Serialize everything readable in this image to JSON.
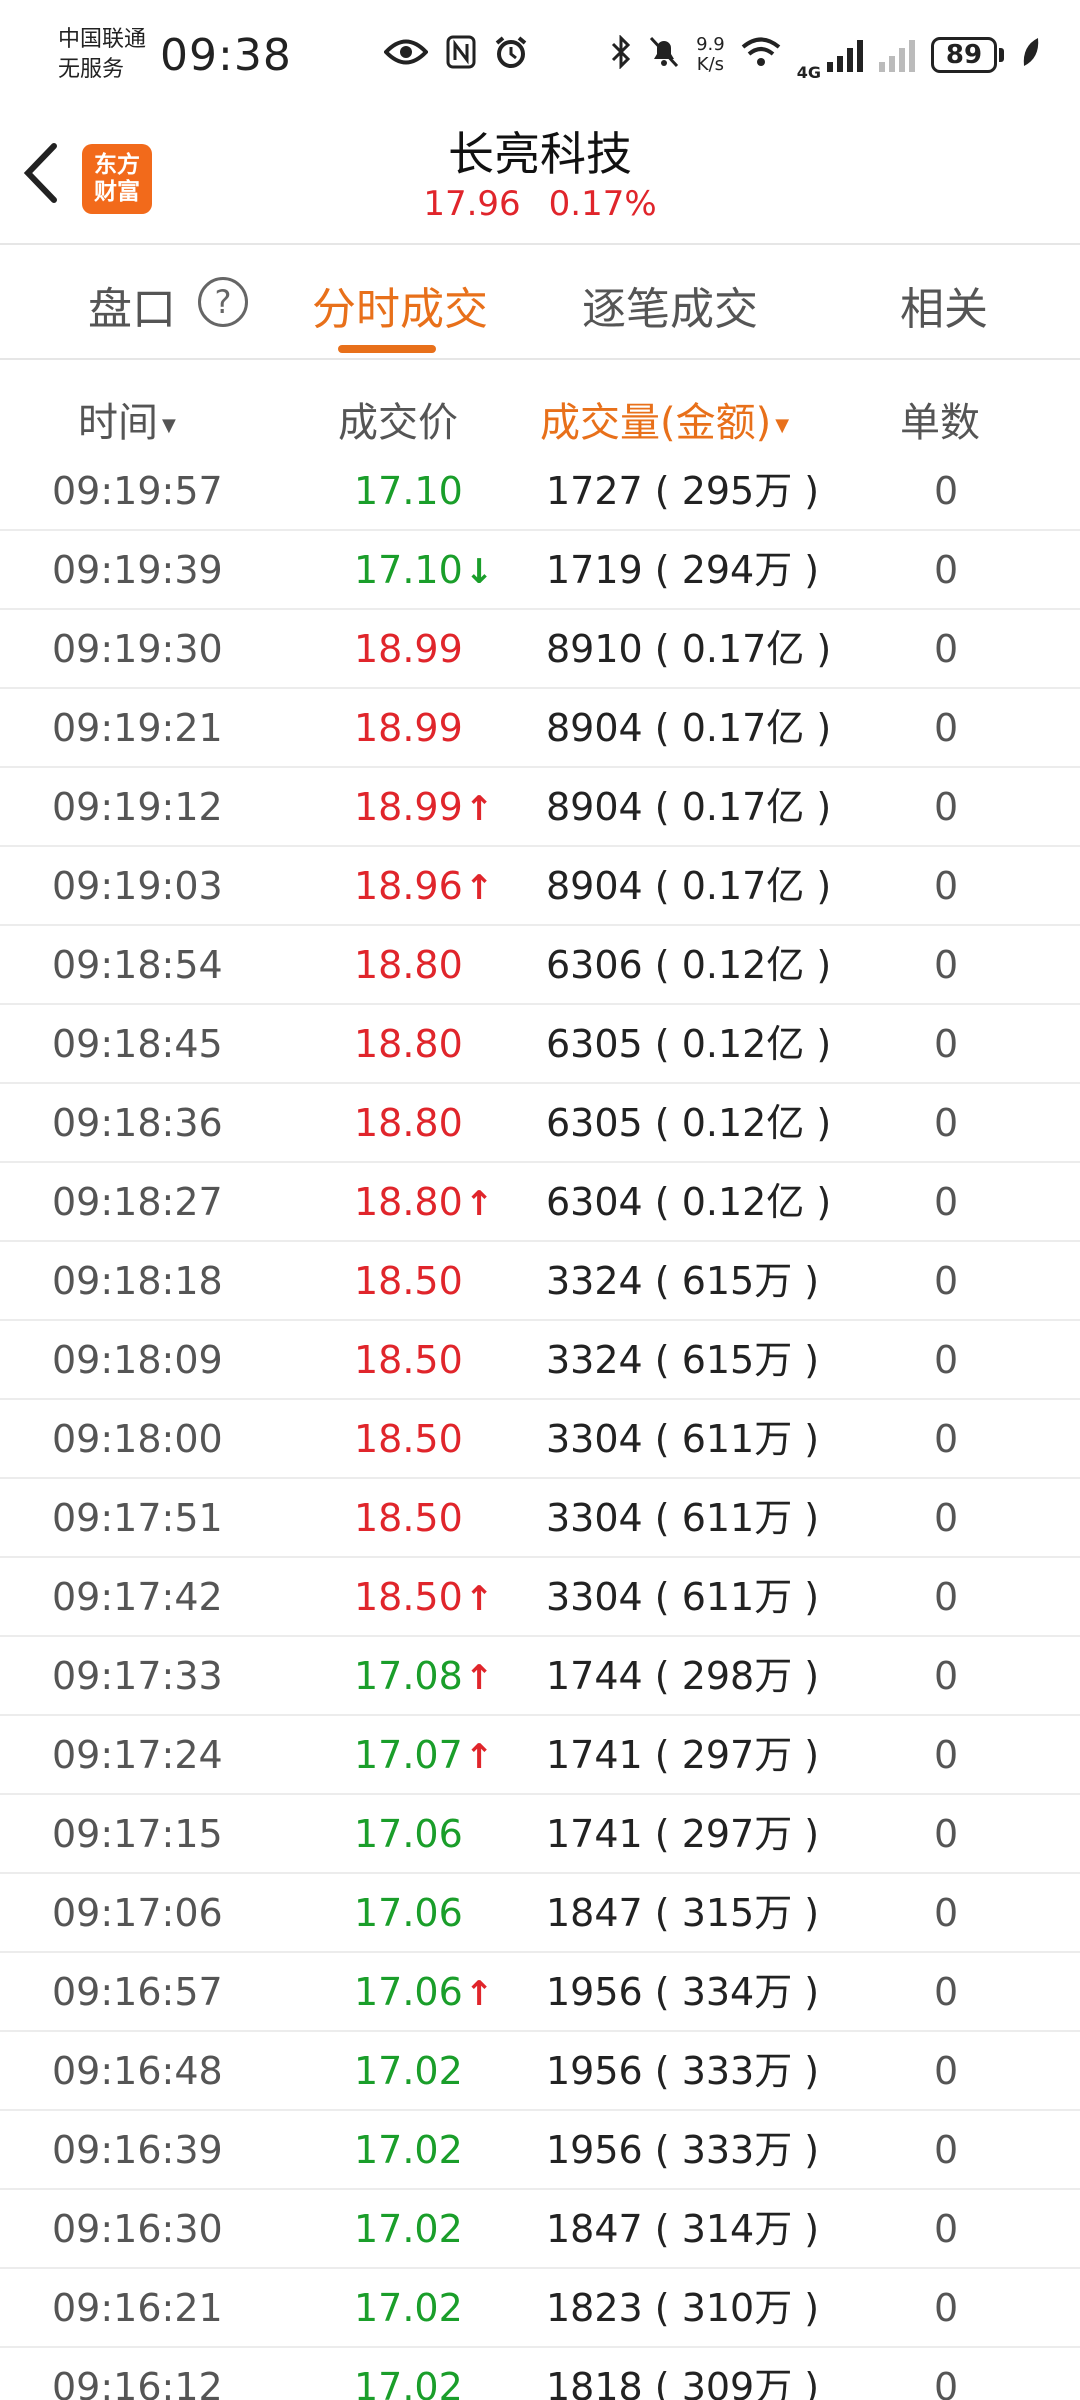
{
  "status_bar": {
    "carrier_line1": "中国联通",
    "carrier_line2": "无服务",
    "time": "09:38",
    "net_speed_value": "9.9",
    "net_speed_unit": "K/s",
    "network_type": "4G",
    "battery": "89"
  },
  "header": {
    "logo_line1": "东方",
    "logo_line2": "财富",
    "title": "长亮科技",
    "price": "17.96",
    "change_pct": "0.17%"
  },
  "tabs": {
    "panel": "盘口",
    "help": "?",
    "intraday_trades": "分时成交",
    "tick_trades": "逐笔成交",
    "related": "相关"
  },
  "columns": {
    "time": "时间",
    "price": "成交价",
    "volume": "成交量(金额)",
    "count": "单数"
  },
  "colors": {
    "up": "#e0252b",
    "down": "#1a9e2a",
    "accent": "#e8701a"
  },
  "trades": [
    {
      "time": "09:19:57",
      "price": "17.10",
      "color": "down",
      "arrow": "",
      "volume": "1727 ( 295万 )",
      "count": "0"
    },
    {
      "time": "09:19:39",
      "price": "17.10",
      "color": "down",
      "arrow": "down",
      "volume": "1719 ( 294万 )",
      "count": "0"
    },
    {
      "time": "09:19:30",
      "price": "18.99",
      "color": "up",
      "arrow": "",
      "volume": "8910 ( 0.17亿 )",
      "count": "0"
    },
    {
      "time": "09:19:21",
      "price": "18.99",
      "color": "up",
      "arrow": "",
      "volume": "8904 ( 0.17亿 )",
      "count": "0"
    },
    {
      "time": "09:19:12",
      "price": "18.99",
      "color": "up",
      "arrow": "up",
      "volume": "8904 ( 0.17亿 )",
      "count": "0"
    },
    {
      "time": "09:19:03",
      "price": "18.96",
      "color": "up",
      "arrow": "up",
      "volume": "8904 ( 0.17亿 )",
      "count": "0"
    },
    {
      "time": "09:18:54",
      "price": "18.80",
      "color": "up",
      "arrow": "",
      "volume": "6306 ( 0.12亿 )",
      "count": "0"
    },
    {
      "time": "09:18:45",
      "price": "18.80",
      "color": "up",
      "arrow": "",
      "volume": "6305 ( 0.12亿 )",
      "count": "0"
    },
    {
      "time": "09:18:36",
      "price": "18.80",
      "color": "up",
      "arrow": "",
      "volume": "6305 ( 0.12亿 )",
      "count": "0"
    },
    {
      "time": "09:18:27",
      "price": "18.80",
      "color": "up",
      "arrow": "up",
      "volume": "6304 ( 0.12亿 )",
      "count": "0"
    },
    {
      "time": "09:18:18",
      "price": "18.50",
      "color": "up",
      "arrow": "",
      "volume": "3324 ( 615万 )",
      "count": "0"
    },
    {
      "time": "09:18:09",
      "price": "18.50",
      "color": "up",
      "arrow": "",
      "volume": "3324 ( 615万 )",
      "count": "0"
    },
    {
      "time": "09:18:00",
      "price": "18.50",
      "color": "up",
      "arrow": "",
      "volume": "3304 ( 611万 )",
      "count": "0"
    },
    {
      "time": "09:17:51",
      "price": "18.50",
      "color": "up",
      "arrow": "",
      "volume": "3304 ( 611万 )",
      "count": "0"
    },
    {
      "time": "09:17:42",
      "price": "18.50",
      "color": "up",
      "arrow": "up",
      "volume": "3304 ( 611万 )",
      "count": "0"
    },
    {
      "time": "09:17:33",
      "price": "17.08",
      "color": "down",
      "arrow": "up",
      "volume": "1744 ( 298万 )",
      "count": "0"
    },
    {
      "time": "09:17:24",
      "price": "17.07",
      "color": "down",
      "arrow": "up",
      "volume": "1741 ( 297万 )",
      "count": "0"
    },
    {
      "time": "09:17:15",
      "price": "17.06",
      "color": "down",
      "arrow": "",
      "volume": "1741 ( 297万 )",
      "count": "0"
    },
    {
      "time": "09:17:06",
      "price": "17.06",
      "color": "down",
      "arrow": "",
      "volume": "1847 ( 315万 )",
      "count": "0"
    },
    {
      "time": "09:16:57",
      "price": "17.06",
      "color": "down",
      "arrow": "up",
      "volume": "1956 ( 334万 )",
      "count": "0"
    },
    {
      "time": "09:16:48",
      "price": "17.02",
      "color": "down",
      "arrow": "",
      "volume": "1956 ( 333万 )",
      "count": "0"
    },
    {
      "time": "09:16:39",
      "price": "17.02",
      "color": "down",
      "arrow": "",
      "volume": "1956 ( 333万 )",
      "count": "0"
    },
    {
      "time": "09:16:30",
      "price": "17.02",
      "color": "down",
      "arrow": "",
      "volume": "1847 ( 314万 )",
      "count": "0"
    },
    {
      "time": "09:16:21",
      "price": "17.02",
      "color": "down",
      "arrow": "",
      "volume": "1823 ( 310万 )",
      "count": "0"
    },
    {
      "time": "09:16:12",
      "price": "17.02",
      "color": "down",
      "arrow": "",
      "volume": "1818 ( 309万 )",
      "count": "0"
    }
  ]
}
